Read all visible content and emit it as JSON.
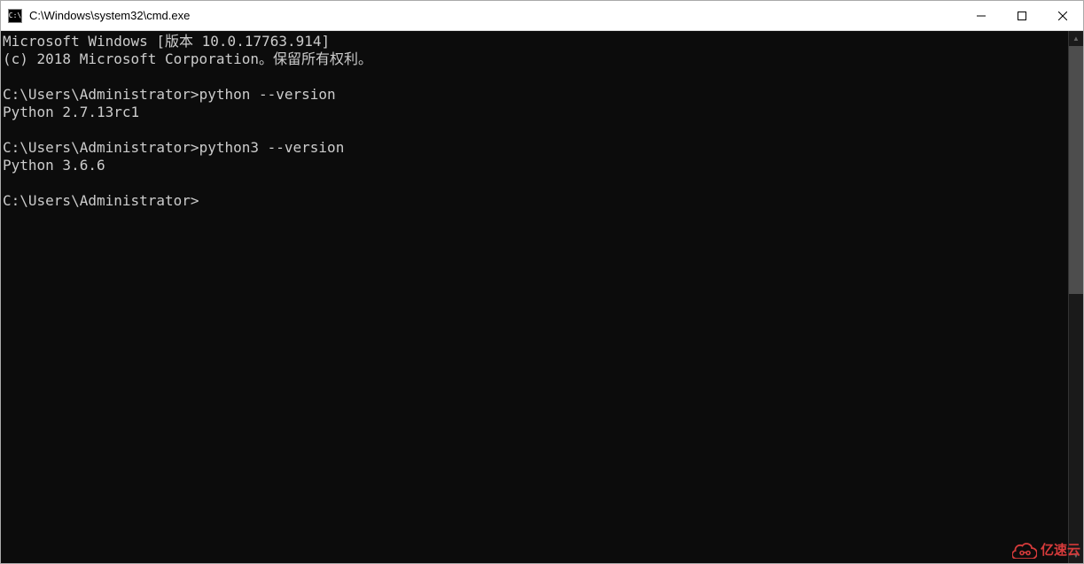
{
  "window": {
    "title": "C:\\Windows\\system32\\cmd.exe",
    "icon_label": "C:\\"
  },
  "terminal": {
    "header_line1": "Microsoft Windows [版本 10.0.17763.914]",
    "header_line2": "(c) 2018 Microsoft Corporation。保留所有权利。",
    "entries": [
      {
        "prompt": "C:\\Users\\Administrator>",
        "command": "python --version",
        "output": "Python 2.7.13rc1"
      },
      {
        "prompt": "C:\\Users\\Administrator>",
        "command": "python3 --version",
        "output": "Python 3.6.6"
      }
    ],
    "current_prompt": "C:\\Users\\Administrator>"
  },
  "watermark": {
    "text": "亿速云"
  }
}
